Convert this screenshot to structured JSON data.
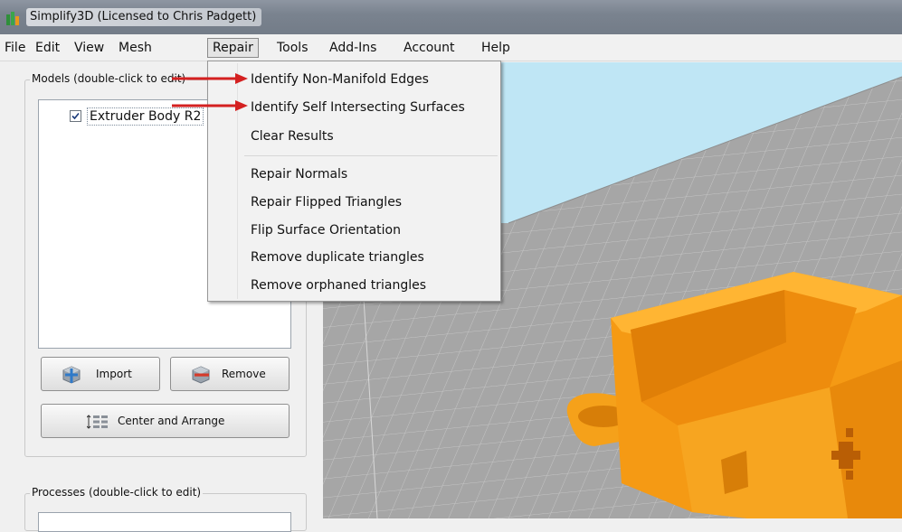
{
  "window": {
    "title": "Simplify3D (Licensed to Chris Padgett)"
  },
  "menubar": {
    "items": [
      "File",
      "Edit",
      "View",
      "Mesh",
      "Repair",
      "Tools",
      "Add-Ins",
      "Account",
      "Help"
    ],
    "open_menu": "Repair"
  },
  "repair_menu": {
    "items": [
      "Identify Non-Manifold Edges",
      "Identify Self Intersecting Surfaces",
      "Clear Results",
      "Repair Normals",
      "Repair Flipped Triangles",
      "Flip Surface Orientation",
      "Remove duplicate triangles",
      "Remove orphaned triangles"
    ]
  },
  "models_panel": {
    "label": "Models (double-click to edit)",
    "models": [
      {
        "name": "Extruder Body R2",
        "checked": true
      }
    ],
    "import_label": "Import",
    "remove_label": "Remove",
    "center_arrange_label": "Center and Arrange"
  },
  "processes_panel": {
    "label": "Processes (double-click to edit)"
  },
  "colors": {
    "model_orange": "#f59a14",
    "viewport_sky": "#bfe6f5",
    "grid_gray": "#a9a9a9",
    "annotation_arrow": "#d42020"
  }
}
